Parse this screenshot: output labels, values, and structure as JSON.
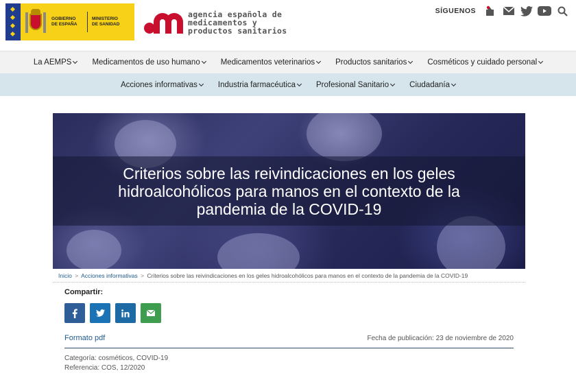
{
  "header": {
    "gov_logo": {
      "line1": "GOBIERNO",
      "line2": "DE ESPAÑA",
      "ministry1": "MINISTERIO",
      "ministry2": "DE SANIDAD"
    },
    "agency_logo": {
      "line1": "agencia española de",
      "line2": "medicamentos y",
      "line3": "productos sanitarios"
    },
    "follow_label": "SÍGUENOS",
    "social_icons": [
      "rss-icon",
      "mail-icon",
      "twitter-icon",
      "youtube-icon",
      "search-icon"
    ]
  },
  "nav_primary": [
    {
      "label": "La AEMPS"
    },
    {
      "label": "Medicamentos de uso humano"
    },
    {
      "label": "Medicamentos veterinarios"
    },
    {
      "label": "Productos sanitarios"
    },
    {
      "label": "Cosméticos y cuidado personal"
    }
  ],
  "nav_secondary": [
    {
      "label": "Acciones informativas"
    },
    {
      "label": "Industria farmacéutica"
    },
    {
      "label": "Profesional Sanitario"
    },
    {
      "label": "Ciudadanía"
    }
  ],
  "hero": {
    "title": "Criterios sobre las reivindicaciones en los geles hidroalcohólicos para manos en el contexto de la pandemia de la COVID-19"
  },
  "breadcrumb": {
    "home": "Inicio",
    "sep": ">",
    "section": "Acciones informativas",
    "current": "Criterios sobre las reivindicaciones en los geles hidroalcohólicos para manos en el contexto de la pandemia de la COVID-19"
  },
  "share": {
    "label": "Compartir:",
    "buttons": [
      "facebook-icon",
      "twitter-icon",
      "linkedin-icon",
      "email-icon"
    ]
  },
  "article": {
    "pdf_label": "Formato pdf",
    "pub_date": "Fecha de publicación: 23 de noviembre de 2020",
    "category": "Categoría: cosméticos, COVID-19",
    "reference": "Referencia: COS, 12/2020"
  },
  "colors": {
    "accent_red": "#c8102e",
    "nav_secondary_bg": "#d5e5eb",
    "link_blue": "#1e5a8e",
    "facebook": "#2f5d97",
    "twitter": "#1b73b5",
    "linkedin": "#1d6aa5",
    "email": "#3e9d4f"
  }
}
